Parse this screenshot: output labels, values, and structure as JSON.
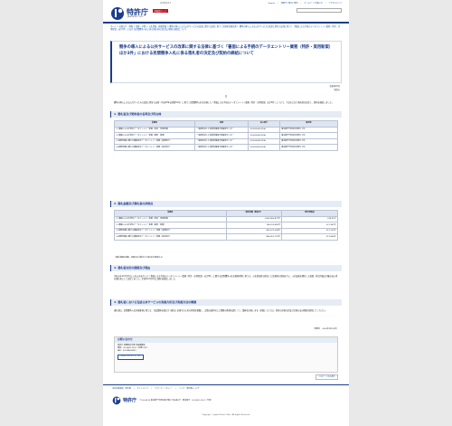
{
  "header": {
    "org_name": "特許庁",
    "org_sub": "JAPAN PATENT OFFICE",
    "lang_button": "外国語ページ",
    "font_size_label": "文字の大きさ",
    "top_links": [
      "English",
      "規範でご案内ご意見",
      "ホームページの使い方",
      "アクセスマップ"
    ]
  },
  "breadcrumb": "ホーム > お知らせ・情報 > 調達・予算 > 入札情報・調達情報 > 競争の導入による公共サービスの改革に関する法律に基づく実施状況報告書 > 競争の導入による公共サービスの改革に関する法律に基づく「書面による手続のデータエントリー業務（特許・実用新案）ほか3件」における民間競争入札に係る落札者の決定及び契約の締結について",
  "title": "競争の導入による公共サービスの改革に関する法律に基づく「書面による手続のデータエントリー業務（特許・実用新案）ほか3件」における民間競争入札に係る落札者の決定及び契約の締結について",
  "date": "令和2年5月",
  "issuer": "特許庁",
  "center_note": "記",
  "intro": "競争の導入による公共サービスの改革に関する法律（平成18年法律第51号）に基づく民間競争入札を実施した「書面による手続のデータエントリー業務（特許・実用新案）ほか3件」について、下記のとおり落札者を決定し、契約を締結しました。",
  "sections": {
    "s1": "1. 落札者及び契約者の名称及び所在地",
    "s2": "2. 落札金額及び落札者の評価点",
    "s3": "3. 落札者決定の経緯及び理由",
    "s4": "4. 落札者における当該公共サービスの実施方針及び実施方法の概要"
  },
  "table1": {
    "headers": [
      "業務名",
      "名称",
      "法人番号",
      "所在地"
    ],
    "rows": [
      [
        "(1)書面による手続のデータエントリー業務（特許・実用新案）",
        "一般財団法人工業所有権電子情報化センター",
        "5010005016746",
        "東京都千代田区永田町1丁目"
      ],
      [
        "(2)書面による手続のデータエントリー業務（意匠・商標）",
        "一般財団法人工業所有権電子情報化センター",
        "5010005016746",
        "東京都千代田区永田町1丁目"
      ],
      [
        "(3)国際出願に関する書面等のデータエントリー業務（受理官庁）",
        "一般財団法人工業所有権電子情報化センター",
        "5010005016746",
        "東京都千代田区永田町1丁目"
      ],
      [
        "(4)国際出願に関する書面等のデータエントリー業務（指定官庁）",
        "一般財団法人工業所有権電子情報化センター",
        "5010005016746",
        "東京都千代田区永田町1丁目"
      ]
    ]
  },
  "table2": {
    "headers": [
      "業務名",
      "落札金額（税抜き）",
      "総合評価点"
    ],
    "rows": [
      [
        "(1)書面による手続のデータエントリー業務（特許・実用新案）",
        "1,092,960,877円",
        "228.91点"
      ],
      [
        "(2)書面による手続のデータエントリー業務（意匠・商標）",
        "764,013,455円",
        "221.587点"
      ],
      [
        "(3)国際出願に関する書面等のデータエントリー業務（受理官庁）",
        "405,472,000円",
        "257.325点"
      ],
      [
        "(4)国際出願に関する書面等のデータエントリー業務（指定官庁）",
        "885,652,712円",
        "213.894点"
      ]
    ]
  },
  "table2_note": "（落札金額は総額、評価点は小数点以下第3位を四捨五入）",
  "section3_text": "令和元年12月13日に入札公告を行った「書面による手続のデータエントリー業務（特許・実用新案）ほか3件」に関する民間競争入札実施要項等に基づき、入札参加者の提出した企画書の評価を行い、入札価格を開札した結果、総合評価点が最も高い者を落札者として決定しました。令和2年3月2日に契約を締結しました。",
  "section4_text": "落札者は、民間競争入札実施要項に基づき、当該業務を適正かつ確実に実施するための体制を整備し、品質の維持向上と経費の削減を図りつつ、業務を実施します。詳細については、別添の実施方針及び実施方法の概要を参照してください。",
  "revision": "［更新日　2020年5月29日］",
  "inquiry": {
    "heading": "お問い合わせ",
    "lines": [
      "特許庁 総務部会計課 企画調整班",
      "電話：03-3581-1101（内線2711）",
      "FAX：03-3580-6951"
    ],
    "button": "お問い合わせフォーム"
  },
  "page_top": "このページの先頭へ",
  "footer": {
    "links": [
      "法的免責事項・著作権",
      "サイトマップ",
      "プライバシーポリシー",
      "リンク・著作権について"
    ],
    "name": "特許庁",
    "address": "〒100-8915 東京都千代田区霞が関3丁目4番3号　電話番号：03-3581-1101（代表）",
    "copyright": "Copyright © Japan Patent Office. All Rights Reserved."
  },
  "colors": {
    "brand": "#1c3d8c",
    "accent": "#c1121f",
    "link": "#1a4fa3"
  }
}
